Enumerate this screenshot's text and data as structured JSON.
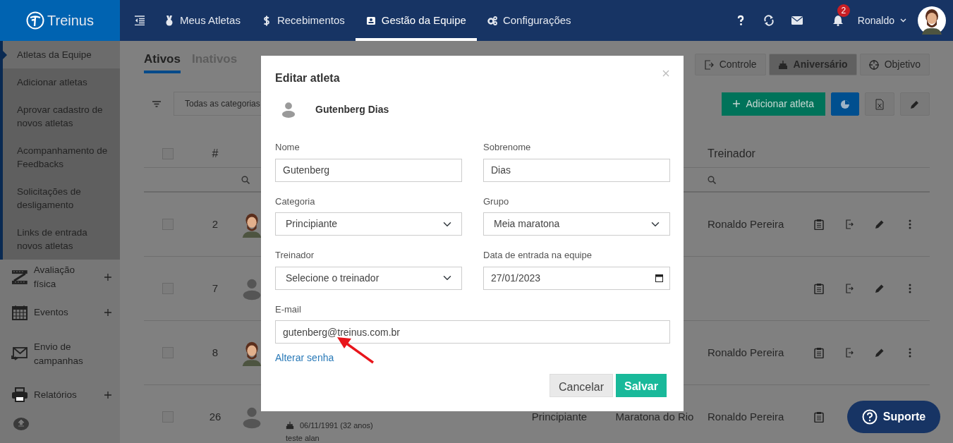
{
  "topbar": {
    "brand": "Treinus",
    "nav": [
      {
        "label": "Meus Atletas",
        "selected": false
      },
      {
        "label": "Recebimentos",
        "selected": false
      },
      {
        "label": "Gestão da Equipe",
        "selected": true
      },
      {
        "label": "Configurações",
        "selected": false
      }
    ],
    "notification_count": "2",
    "user": {
      "name": "Ronaldo"
    }
  },
  "sidebar": {
    "submenu": [
      {
        "label": "Atletas da Equipe",
        "selected": true
      },
      {
        "label": "Adicionar atletas",
        "selected": false
      },
      {
        "label": "Aprovar cadastro de novos atletas",
        "selected": false
      },
      {
        "label": "Acompanhamento de Feedbacks",
        "selected": false
      },
      {
        "label": "Solicitações de desligamento",
        "selected": false
      },
      {
        "label": "Links de entrada novos atletas",
        "selected": false
      }
    ],
    "sections": [
      {
        "label": "Avaliação física",
        "expandable": true
      },
      {
        "label": "Eventos",
        "expandable": true
      },
      {
        "label": "Envio de campanhas",
        "expandable": false
      },
      {
        "label": "Relatórios",
        "expandable": true
      }
    ]
  },
  "tabs": [
    {
      "label": "Ativos",
      "selected": true
    },
    {
      "label": "Inativos",
      "selected": false
    }
  ],
  "view_buttons": [
    {
      "label": "Controle",
      "selected": false
    },
    {
      "label": "Aniversário",
      "selected": true
    },
    {
      "label": "Objetivo",
      "selected": false
    }
  ],
  "filter": {
    "value": "Todas as categorias"
  },
  "add_button": {
    "label": "Adicionar atleta"
  },
  "table": {
    "select_all": {
      "checked": false
    },
    "headers": {
      "number": "#",
      "trainer": "Treinador"
    },
    "rows": [
      {
        "checked": false,
        "number": "2",
        "avatar": {
          "kind": "photo"
        },
        "trainer": "Ronaldo Pereira"
      },
      {
        "checked": false,
        "number": "7",
        "avatar": {
          "kind": "default"
        }
      },
      {
        "checked": false,
        "number": "8",
        "avatar": {
          "kind": "photo"
        },
        "trainer": "Ronaldo Pereira"
      },
      {
        "checked": false,
        "number": "26",
        "avatar": {
          "kind": "default"
        },
        "birthday": "06/11/1991 (32 anos)",
        "note": "teste alan",
        "category": "Principiante",
        "group": "Maratona do Rio",
        "trainer": "Ronaldo Pereira"
      }
    ]
  },
  "modal": {
    "title": "Editar atleta",
    "athlete_name": "Gutenberg Dias",
    "fields": [
      {
        "label": "Nome",
        "kind": "text",
        "value": "Gutenberg"
      },
      {
        "label": "Sobrenome",
        "kind": "text",
        "value": "Dias"
      },
      {
        "label": "Categoria",
        "kind": "select",
        "value": "Principiante"
      },
      {
        "label": "Grupo",
        "kind": "select",
        "value": "Meia maratona"
      },
      {
        "label": "Treinador",
        "kind": "select",
        "value": "Selecione o treinador"
      },
      {
        "label": "Data de entrada na equipe",
        "kind": "date",
        "value": "27/01/2023"
      },
      {
        "label": "E-mail",
        "kind": "wide",
        "value": "gutenberg@treinus.com.br"
      }
    ],
    "link": "Alterar senha",
    "buttons": [
      {
        "label": "Cancelar",
        "kind": "secondary"
      },
      {
        "label": "Salvar",
        "kind": "primary"
      }
    ]
  },
  "support_button": {
    "label": "Suporte"
  }
}
